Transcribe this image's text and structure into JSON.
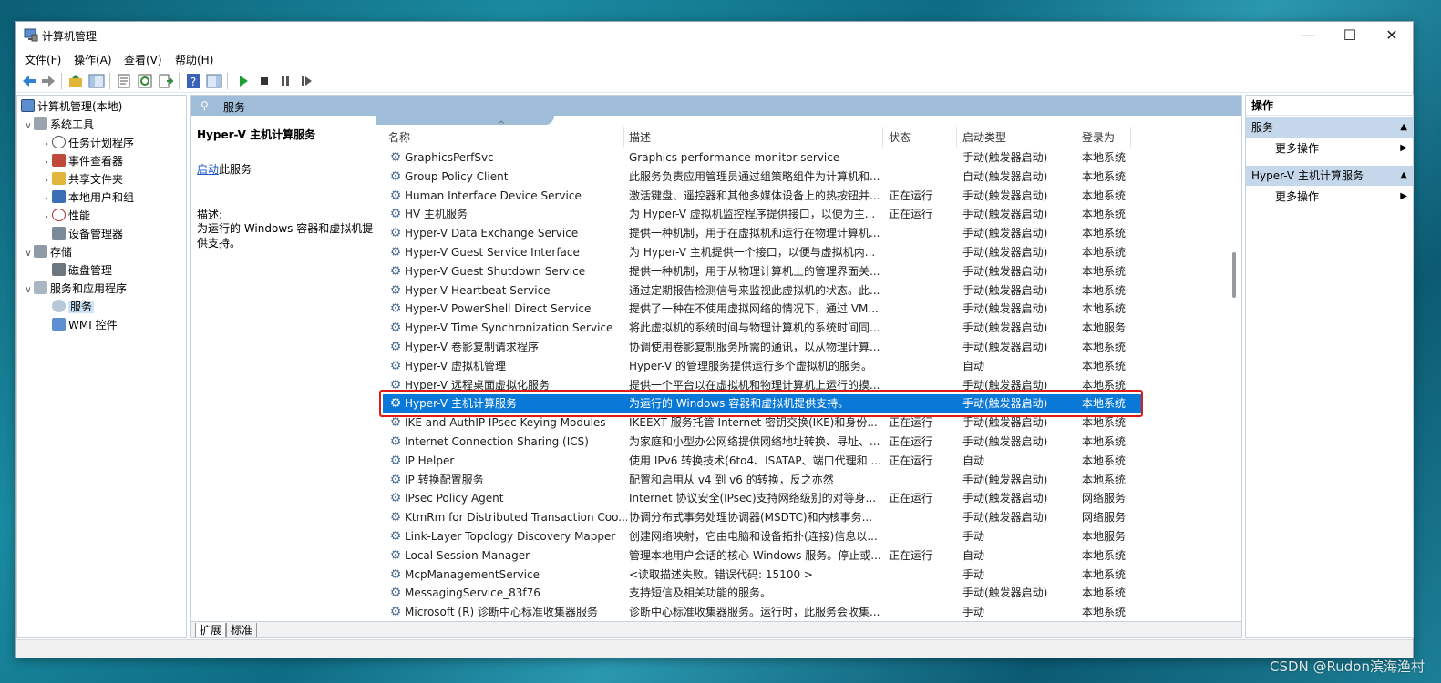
{
  "window": {
    "title": "计算机管理",
    "controls": {
      "minimize": "—",
      "maximize": "☐",
      "close": "✕"
    }
  },
  "menu": [
    "文件(F)",
    "操作(A)",
    "查看(V)",
    "帮助(H)"
  ],
  "tree": {
    "root": "计算机管理(本地)",
    "system_tools": "系统工具",
    "task_scheduler": "任务计划程序",
    "event_viewer": "事件查看器",
    "shared_folders": "共享文件夹",
    "local_users": "本地用户和组",
    "performance": "性能",
    "device_manager": "设备管理器",
    "storage": "存储",
    "disk_management": "磁盘管理",
    "services_apps": "服务和应用程序",
    "services": "服务",
    "wmi": "WMI 控件"
  },
  "center": {
    "header_title": "服务",
    "detail": {
      "title": "Hyper-V 主机计算服务",
      "start_link": "启动",
      "start_suffix": "此服务",
      "desc_label": "描述:",
      "desc_text": "为运行的 Windows 容器和虚拟机提供支持。"
    },
    "columns": {
      "name": "名称",
      "desc": "描述",
      "status": "状态",
      "startup": "启动类型",
      "logon": "登录为"
    },
    "sort_indicator": "^",
    "rows": [
      {
        "name": "GraphicsPerfSvc",
        "desc": "Graphics performance monitor service",
        "status": "",
        "startup": "手动(触发器启动)",
        "logon": "本地系统"
      },
      {
        "name": "Group Policy Client",
        "desc": "此服务负责应用管理员通过组策略组件为计算机和...",
        "status": "",
        "startup": "自动(触发器启动)",
        "logon": "本地系统"
      },
      {
        "name": "Human Interface Device Service",
        "desc": "激活键盘、遥控器和其他多媒体设备上的热按钮并...",
        "status": "正在运行",
        "startup": "手动(触发器启动)",
        "logon": "本地系统"
      },
      {
        "name": "HV 主机服务",
        "desc": "为 Hyper-V 虚拟机监控程序提供接口，以便为主...",
        "status": "正在运行",
        "startup": "手动(触发器启动)",
        "logon": "本地系统"
      },
      {
        "name": "Hyper-V Data Exchange Service",
        "desc": "提供一种机制，用于在虚拟机和运行在物理计算机...",
        "status": "",
        "startup": "手动(触发器启动)",
        "logon": "本地系统"
      },
      {
        "name": "Hyper-V Guest Service Interface",
        "desc": "为 Hyper-V 主机提供一个接口，以便与虚拟机内...",
        "status": "",
        "startup": "手动(触发器启动)",
        "logon": "本地系统"
      },
      {
        "name": "Hyper-V Guest Shutdown Service",
        "desc": "提供一种机制，用于从物理计算机上的管理界面关...",
        "status": "",
        "startup": "手动(触发器启动)",
        "logon": "本地系统"
      },
      {
        "name": "Hyper-V Heartbeat Service",
        "desc": "通过定期报告检测信号来监视此虚拟机的状态。此...",
        "status": "",
        "startup": "手动(触发器启动)",
        "logon": "本地系统"
      },
      {
        "name": "Hyper-V PowerShell Direct Service",
        "desc": "提供了一种在不使用虚拟网络的情况下，通过 VM...",
        "status": "",
        "startup": "手动(触发器启动)",
        "logon": "本地系统"
      },
      {
        "name": "Hyper-V Time Synchronization Service",
        "desc": "将此虚拟机的系统时间与物理计算机的系统时间同...",
        "status": "",
        "startup": "手动(触发器启动)",
        "logon": "本地服务"
      },
      {
        "name": "Hyper-V 卷影复制请求程序",
        "desc": "协调使用卷影复制服务所需的通讯，以从物理计算...",
        "status": "",
        "startup": "手动(触发器启动)",
        "logon": "本地系统"
      },
      {
        "name": "Hyper-V 虚拟机管理",
        "desc": "Hyper-V 的管理服务提供运行多个虚拟机的服务。",
        "status": "",
        "startup": "自动",
        "logon": "本地系统"
      },
      {
        "name": "Hyper-V 远程桌面虚拟化服务",
        "desc": "提供一个平台以在虚拟机和物理计算机上运行的摸...",
        "status": "",
        "startup": "手动(触发器启动)",
        "logon": "本地系统"
      },
      {
        "name": "Hyper-V 主机计算服务",
        "desc": "为运行的 Windows 容器和虚拟机提供支持。",
        "status": "",
        "startup": "手动(触发器启动)",
        "logon": "本地系统",
        "selected": true
      },
      {
        "name": "IKE and AuthIP IPsec Keying Modules",
        "desc": "IKEEXT 服务托管 Internet 密钥交换(IKE)和身份...",
        "status": "正在运行",
        "startup": "手动(触发器启动)",
        "logon": "本地系统"
      },
      {
        "name": "Internet Connection Sharing (ICS)",
        "desc": "为家庭和小型办公网络提供网络地址转换、寻址、...",
        "status": "正在运行",
        "startup": "手动(触发器启动)",
        "logon": "本地系统"
      },
      {
        "name": "IP Helper",
        "desc": "使用 IPv6 转换技术(6to4、ISATAP、端口代理和 ...",
        "status": "正在运行",
        "startup": "自动",
        "logon": "本地系统"
      },
      {
        "name": "IP 转换配置服务",
        "desc": "配置和启用从 v4 到 v6 的转换，反之亦然",
        "status": "",
        "startup": "手动(触发器启动)",
        "logon": "本地系统"
      },
      {
        "name": "IPsec Policy Agent",
        "desc": "Internet 协议安全(IPsec)支持网络级别的对等身...",
        "status": "正在运行",
        "startup": "手动(触发器启动)",
        "logon": "网络服务"
      },
      {
        "name": "KtmRm for Distributed Transaction Coo...",
        "desc": "协调分布式事务处理协调器(MSDTC)和内核事务...",
        "status": "",
        "startup": "手动(触发器启动)",
        "logon": "网络服务"
      },
      {
        "name": "Link-Layer Topology Discovery Mapper",
        "desc": "创建网络映射，它由电脑和设备拓扑(连接)信息以...",
        "status": "",
        "startup": "手动",
        "logon": "本地服务"
      },
      {
        "name": "Local Session Manager",
        "desc": "管理本地用户会话的核心 Windows 服务。停止或...",
        "status": "正在运行",
        "startup": "自动",
        "logon": "本地系统"
      },
      {
        "name": "McpManagementService",
        "desc": "<读取描述失败。错误代码: 15100 >",
        "status": "",
        "startup": "手动",
        "logon": "本地系统"
      },
      {
        "name": "MessagingService_83f76",
        "desc": "支持短信及相关功能的服务。",
        "status": "",
        "startup": "手动(触发器启动)",
        "logon": "本地系统"
      },
      {
        "name": "Microsoft (R) 诊断中心标准收集器服务",
        "desc": "诊断中心标准收集器服务。运行时，此服务会收集...",
        "status": "",
        "startup": "手动",
        "logon": "本地系统"
      }
    ],
    "tabs": [
      "扩展",
      "标准"
    ]
  },
  "actions": {
    "header": "操作",
    "section1": "服务",
    "more1": "更多操作",
    "section2": "Hyper-V 主机计算服务",
    "more2": "更多操作"
  },
  "watermark": "CSDN @Rudon滨海渔村"
}
